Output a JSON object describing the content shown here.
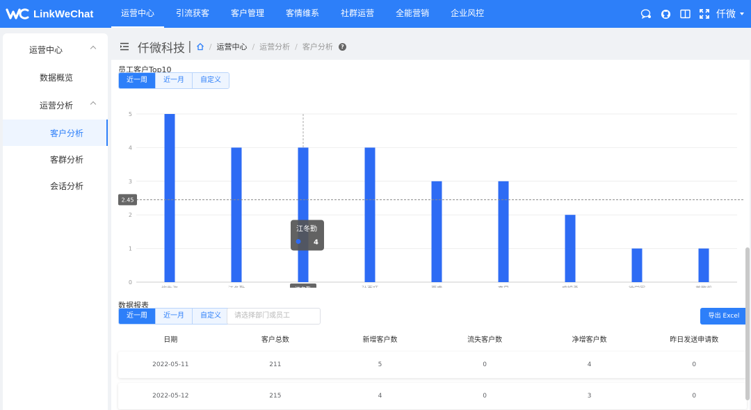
{
  "app": {
    "name": "LinkWeChat",
    "brand_color": "#2d7ff9"
  },
  "nav": {
    "items": [
      {
        "label": "运营中心",
        "active": true
      },
      {
        "label": "引流获客"
      },
      {
        "label": "客户管理"
      },
      {
        "label": "客情维系"
      },
      {
        "label": "社群运营"
      },
      {
        "label": "全能营销"
      },
      {
        "label": "企业风控"
      }
    ],
    "user": "仟微",
    "icons": [
      "message-icon",
      "github-icon",
      "book-icon",
      "fullscreen-icon"
    ]
  },
  "sidebar": {
    "items": [
      {
        "label": "运营中心",
        "expanded": true
      },
      {
        "label": "数据概览"
      },
      {
        "label": "运营分析",
        "expanded": true
      },
      {
        "label": "客户分析",
        "active": true
      },
      {
        "label": "客群分析"
      },
      {
        "label": "会话分析"
      }
    ]
  },
  "breadcrumb": {
    "company": "仟微科技",
    "sep": "|",
    "items": [
      "运营中心",
      "运营分析",
      "客户分析"
    ],
    "divider": "/"
  },
  "top10": {
    "title": "员工客户Top10",
    "ranges": [
      "近一周",
      "近一月",
      "自定义"
    ]
  },
  "chart_data": {
    "type": "bar",
    "title": "员工客户Top10",
    "categories": [
      "柳生海",
      "江冬勤",
      "江冬勤",
      "孙喜旺",
      "夏睿",
      "李昂",
      "盛锡勇",
      "徐学军",
      "姜鹏凯"
    ],
    "values": [
      5,
      4,
      4,
      4,
      3,
      3,
      2,
      1,
      1
    ],
    "ylim": [
      0,
      5
    ],
    "yticks": [
      0,
      1,
      2,
      3,
      4,
      5
    ],
    "grid": true,
    "color": "#2d6bf4",
    "average_line": 2.45,
    "average_label": "2.45",
    "hover_index": 2,
    "tooltip": {
      "name": "江冬勤",
      "value": "4"
    },
    "hover_axis_label": "江冬勤"
  },
  "report": {
    "title": "数据报表",
    "ranges": [
      "近一周",
      "近一月",
      "自定义"
    ],
    "search_placeholder": "请选择部门或员工",
    "export_label": "导出 Excel",
    "columns": [
      "日期",
      "客户总数",
      "新增客户数",
      "流失客户数",
      "净增客户数",
      "昨日发送申请数"
    ],
    "rows": [
      [
        "2022-05-11",
        "211",
        "5",
        "0",
        "4",
        "0"
      ],
      [
        "2022-05-12",
        "215",
        "4",
        "0",
        "3",
        "0"
      ]
    ]
  }
}
